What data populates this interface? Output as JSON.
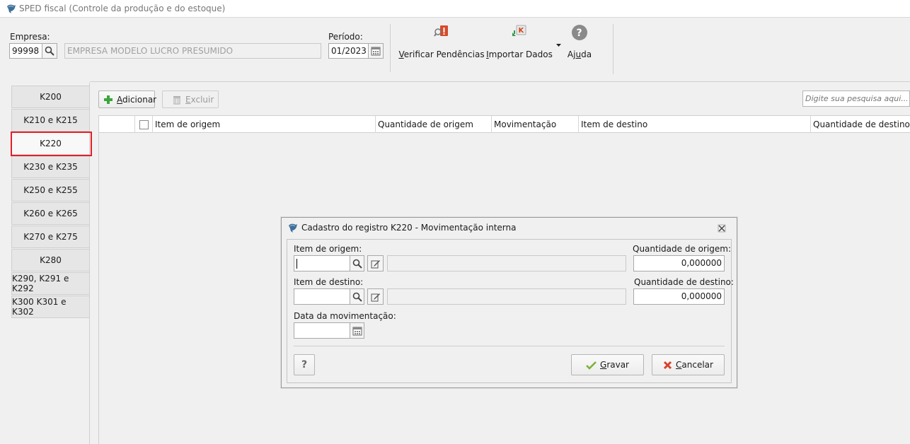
{
  "window": {
    "title": "SPED fiscal (Controle da produção e do estoque)"
  },
  "header": {
    "empresa_label": "Empresa:",
    "empresa_code": "99998",
    "empresa_name": "EMPRESA MODELO LUCRO PRESUMIDO",
    "periodo_label": "Período:",
    "periodo_value": "01/2023"
  },
  "toolbar": {
    "verificar_first": "V",
    "verificar_rest": "erificar Pendências",
    "importar_first": "I",
    "importar_rest": "mportar Dados",
    "ajuda_pre": "Aj",
    "ajuda_ul": "u",
    "ajuda_post": "da"
  },
  "tabs": [
    {
      "label": "K200"
    },
    {
      "label": "K210 e K215"
    },
    {
      "label": "K220"
    },
    {
      "label": "K230 e K235"
    },
    {
      "label": "K250 e K255"
    },
    {
      "label": "K260 e K265"
    },
    {
      "label": "K270 e K275"
    },
    {
      "label": "K280"
    },
    {
      "label": "K290, K291 e K292"
    },
    {
      "label": "K300 K301 e K302"
    }
  ],
  "actions": {
    "adicionar_first": "A",
    "adicionar_rest": "dicionar",
    "excluir_first": "E",
    "excluir_rest": "xcluir",
    "search_placeholder": "Digite sua pesquisa aqui..."
  },
  "grid": {
    "columns": [
      "Item de origem",
      "Quantidade de origem",
      "Movimentação",
      "Item de destino",
      "Quantidade de destino"
    ]
  },
  "dialog": {
    "title": "Cadastro do registro K220 - Movimentação interna",
    "item_origem_label": "Item de origem:",
    "qtd_origem_label": "Quantidade de origem:",
    "qtd_origem_value": "0,000000",
    "item_destino_label": "Item de destino:",
    "qtd_destino_label": "Quantidade de destino:",
    "qtd_destino_value": "0,000000",
    "data_label": "Data da movimentação:",
    "help_label": "?",
    "gravar_first": "G",
    "gravar_rest": "ravar",
    "cancelar_first": "C",
    "cancelar_rest": "ancelar"
  },
  "colors": {
    "highlight": "#e2202a",
    "add_green": "#3aa63a",
    "cancel_red": "#d9412b"
  }
}
